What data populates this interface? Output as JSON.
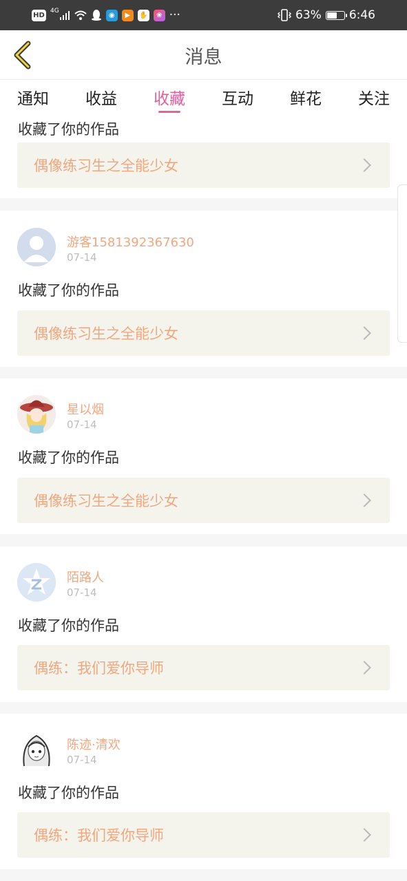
{
  "status_bar": {
    "hd": "HD",
    "network": "4G",
    "more": "···",
    "battery_percent": "63%",
    "time": "6:46",
    "battery_level": 0.63
  },
  "header": {
    "title": "消息"
  },
  "tabs": [
    {
      "label": "通知"
    },
    {
      "label": "收益"
    },
    {
      "label": "收藏",
      "active": true
    },
    {
      "label": "互动"
    },
    {
      "label": "鲜花"
    },
    {
      "label": "关注"
    }
  ],
  "partial_card": {
    "text": "收藏了你的作品",
    "work_title": "偶像练习生之全能少女"
  },
  "messages": [
    {
      "username": "游客1581392367630",
      "date": "07-14",
      "text": "收藏了你的作品",
      "work_title": "偶像练习生之全能少女",
      "avatar": "default-avatar"
    },
    {
      "username": "星以烟",
      "date": "07-14",
      "text": "收藏了你的作品",
      "work_title": "偶像练习生之全能少女",
      "avatar": "anime-girl-witch-hat"
    },
    {
      "username": "陌路人",
      "date": "07-14",
      "text": "收藏了你的作品",
      "work_title": "偶练：我们爱你导师",
      "avatar": "qq-zone-logo"
    },
    {
      "username": "陈迹·清欢",
      "date": "07-14",
      "text": "收藏了你的作品",
      "work_title": "偶练：我们爱你导师",
      "avatar": "sketch-girl"
    }
  ],
  "colors": {
    "accent": "#e6609a",
    "username": "#f0a77f",
    "work_bg": "#f4f4ec",
    "status_bg": "#3c3c3c"
  }
}
